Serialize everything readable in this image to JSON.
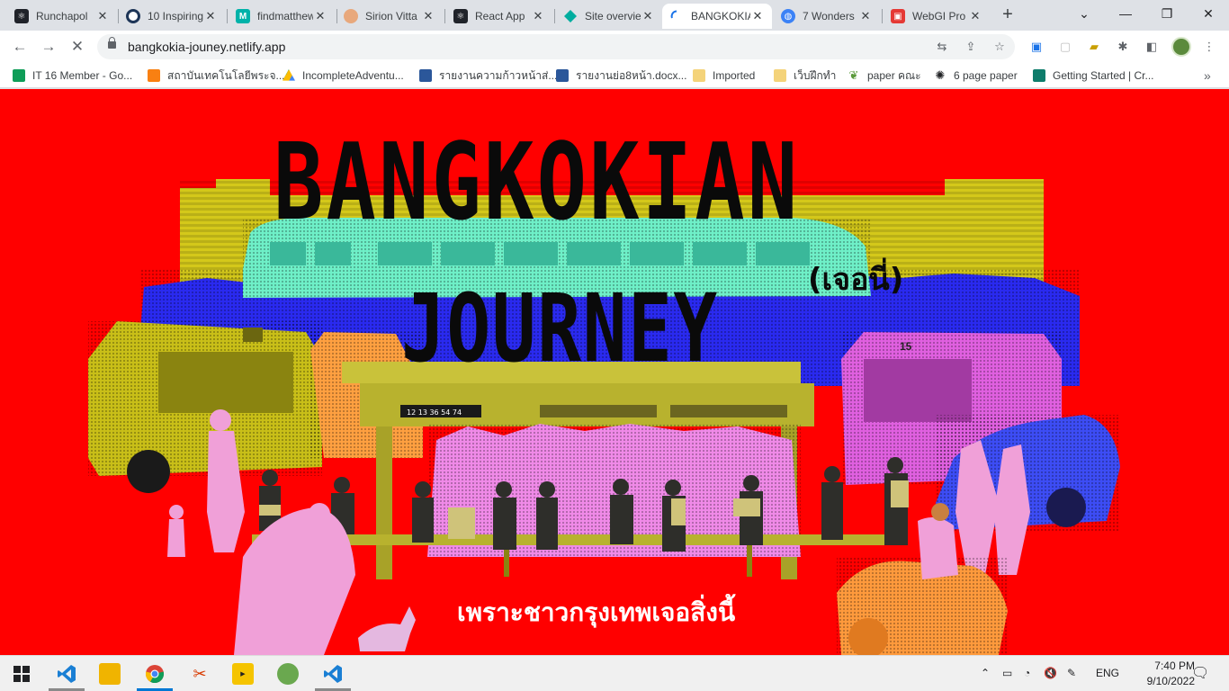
{
  "browser": {
    "tabs": [
      {
        "title": "Runchapol",
        "icon": "react-icon",
        "color": "#20232a"
      },
      {
        "title": "10 Inspiring",
        "icon": "target-icon",
        "color": "#1d3557"
      },
      {
        "title": "findmatthew",
        "icon": "m-logo-icon",
        "color": "#00b2a9"
      },
      {
        "title": "Sirion Vitta",
        "icon": "sun-icon",
        "color": "#e8a87c"
      },
      {
        "title": "React App",
        "icon": "react-icon",
        "color": "#20232a"
      },
      {
        "title": "Site overview",
        "icon": "netlify-icon",
        "color": "#00ad9f"
      },
      {
        "title": "BANGKOKIA",
        "icon": "loading-spinner-icon",
        "color": "#1a73e8"
      },
      {
        "title": "7 Wonders",
        "icon": "globe-icon",
        "color": "#3b82f6"
      },
      {
        "title": "WebGI Pro",
        "icon": "webgi-icon",
        "color": "#e53935"
      }
    ],
    "active_tab_index": 6,
    "new_tab_label": "+",
    "url": "bangkokia-jouney.netlify.app",
    "bookmarks": [
      {
        "label": "IT 16 Member - Go...",
        "icon": "sheets-icon",
        "color": "#0f9d58"
      },
      {
        "label": "สถาบันเทคโนโลยีพระจ...",
        "icon": "moodle-icon",
        "color": "#f98012"
      },
      {
        "label": "IncompleteAdventu...",
        "icon": "drive-icon",
        "color": "#fbbc04"
      },
      {
        "label": "รายงานความก้าวหน้าส่...",
        "icon": "word-icon",
        "color": "#2b579a"
      },
      {
        "label": "รายงานย่อ8หน้า.docx...",
        "icon": "word-icon",
        "color": "#2b579a"
      },
      {
        "label": "Imported",
        "icon": "folder-icon",
        "color": "#f4d37a"
      },
      {
        "label": "เว็บฝึกทำ",
        "icon": "folder-icon",
        "color": "#f4d37a"
      },
      {
        "label": "paper คณะ",
        "icon": "leaf-icon",
        "color": "#5b9a3c"
      },
      {
        "label": "6 page paper",
        "icon": "openai-icon",
        "color": "#202124"
      },
      {
        "label": "Getting Started | Cr...",
        "icon": "cube-icon",
        "color": "#0e7c6b"
      }
    ]
  },
  "page": {
    "title_line1": "BANGKOKIAN",
    "title_line2": "JOURNEY",
    "title_thai": "(เจอนี่)",
    "subtitle": "เพราะชาวกรุงเทพเจอสิ่งนี้",
    "bus_stop_sign": "12 13 36 54 74",
    "bus_number": "15",
    "colors": {
      "background": "#ff0000",
      "yellow": "#d4c81a",
      "blue": "#2a2af0",
      "mint": "#6ff0c8",
      "magenta": "#e060e0",
      "orange": "#ff9a3c",
      "pink": "#f0a0d8",
      "text_dark": "#0a0a0a",
      "text_light": "#ffffff"
    }
  },
  "taskbar": {
    "apps": [
      {
        "name": "windows-start-icon",
        "color": "#0078d4"
      },
      {
        "name": "vscode-icon",
        "color": "#0065a9"
      },
      {
        "name": "file-explorer-icon",
        "color": "#f0b400"
      },
      {
        "name": "chrome-icon",
        "color": "#4285f4"
      },
      {
        "name": "snipping-tool-icon",
        "color": "#d83b01"
      },
      {
        "name": "player-icon",
        "color": "#f5c400"
      },
      {
        "name": "chameleon-icon",
        "color": "#6aa84f"
      },
      {
        "name": "vscode-icon",
        "color": "#0065a9"
      }
    ],
    "tray_language": "ENG",
    "time": "7:40 PM",
    "date": "9/10/2022"
  }
}
